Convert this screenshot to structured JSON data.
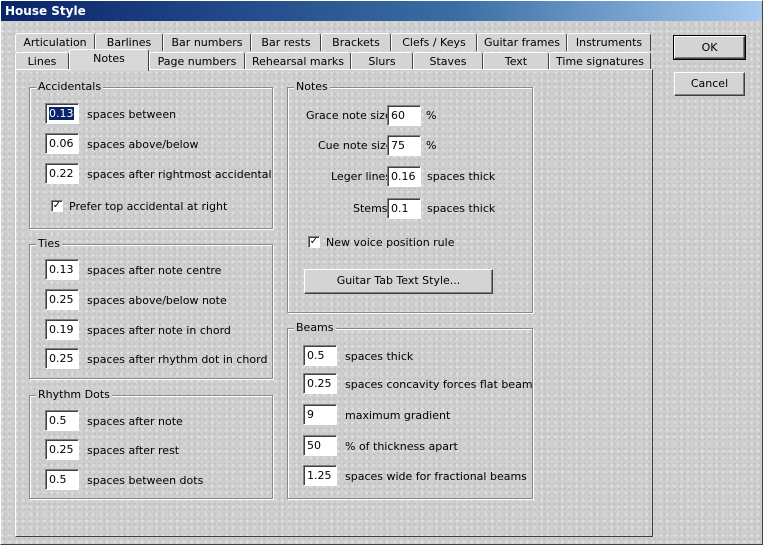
{
  "window": {
    "title": "House Style"
  },
  "tabs_row1": [
    "Articulation",
    "Barlines",
    "Bar numbers",
    "Bar rests",
    "Brackets",
    "Clefs / Keys",
    "Guitar frames",
    "Instruments"
  ],
  "tabs_row2": [
    "Lines",
    "Notes",
    "Page numbers",
    "Rehearsal marks",
    "Slurs",
    "Staves",
    "Text",
    "Time signatures"
  ],
  "accidentals": {
    "title": "Accidentals",
    "rows": [
      {
        "value": "0.13",
        "label": "spaces between"
      },
      {
        "value": "0.06",
        "label": "spaces above/below"
      },
      {
        "value": "0.22",
        "label": "spaces after rightmost accidental"
      }
    ],
    "prefer_top": {
      "checked": "✓",
      "label": "Prefer top accidental at right"
    }
  },
  "ties": {
    "title": "Ties",
    "rows": [
      {
        "value": "0.13",
        "label": "spaces after note centre"
      },
      {
        "value": "0.25",
        "label": "spaces above/below note"
      },
      {
        "value": "0.19",
        "label": "spaces after note in chord"
      },
      {
        "value": "0.25",
        "label": "spaces after rhythm dot in chord"
      }
    ]
  },
  "rhythm_dots": {
    "title": "Rhythm Dots",
    "rows": [
      {
        "value": "0.5",
        "label": "spaces after note"
      },
      {
        "value": "0.25",
        "label": "spaces after rest"
      },
      {
        "value": "0.5",
        "label": "spaces between dots"
      }
    ]
  },
  "notes": {
    "title": "Notes",
    "grace": {
      "label": "Grace note size",
      "value": "60",
      "unit": "%"
    },
    "cue": {
      "label": "Cue note size",
      "value": "75",
      "unit": "%"
    },
    "leger": {
      "label": "Leger lines",
      "value": "0.16",
      "unit": "spaces thick"
    },
    "stems": {
      "label": "Stems",
      "value": "0.1",
      "unit": "spaces thick"
    },
    "new_voice": {
      "checked": "✓",
      "label": "New voice position rule"
    },
    "guitar_button": "Guitar Tab Text Style..."
  },
  "beams": {
    "title": "Beams",
    "rows": [
      {
        "value": "0.5",
        "label": "spaces thick"
      },
      {
        "value": "0.25",
        "label": "spaces concavity forces flat beam"
      },
      {
        "value": "9",
        "label": "maximum gradient"
      },
      {
        "value": "50",
        "label": "% of thickness apart"
      },
      {
        "value": "1.25",
        "label": "spaces wide for fractional beams"
      }
    ]
  },
  "buttons": {
    "ok": "OK",
    "cancel": "Cancel"
  }
}
